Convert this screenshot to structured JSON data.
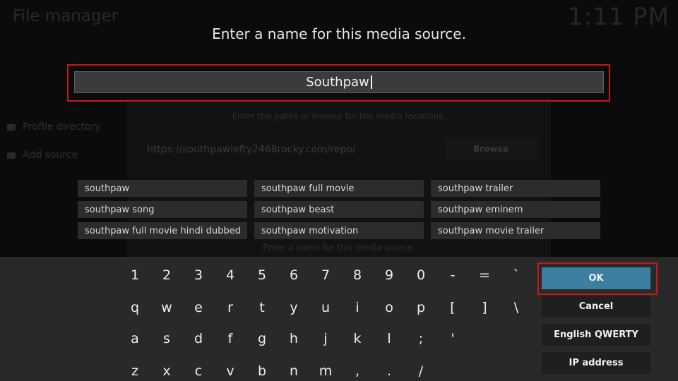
{
  "background": {
    "title": "File manager",
    "clock": "1:11 PM",
    "side_items": [
      "Profile directory",
      "Add source"
    ],
    "paths_hint": "Enter the paths or browse for the media locations.",
    "url": "https://southpawlefty2468rocky.com/repo/",
    "browse_label": "Browse",
    "name_hint": "Enter a name for this media source."
  },
  "dialog": {
    "heading": "Enter a name for this media source.",
    "input_value": "Southpaw"
  },
  "suggestions": [
    "southpaw",
    "southpaw full movie",
    "southpaw trailer",
    "southpaw song",
    "southpaw beast",
    "southpaw eminem",
    "southpaw full movie hindi dubbed",
    "southpaw motivation",
    "southpaw movie trailer"
  ],
  "keyboard": {
    "rows": [
      [
        "1",
        "2",
        "3",
        "4",
        "5",
        "6",
        "7",
        "8",
        "9",
        "0",
        "-",
        "=",
        "`"
      ],
      [
        "q",
        "w",
        "e",
        "r",
        "t",
        "y",
        "u",
        "i",
        "o",
        "p",
        "[",
        "]",
        "\\"
      ],
      [
        "a",
        "s",
        "d",
        "f",
        "g",
        "h",
        "j",
        "k",
        "l",
        ";",
        "'"
      ],
      [
        "z",
        "x",
        "c",
        "v",
        "b",
        "n",
        "m",
        ",",
        ".",
        "/"
      ]
    ],
    "buttons": {
      "ok": "OK",
      "cancel": "Cancel",
      "layout": "English QWERTY",
      "ip": "IP address"
    }
  },
  "colors": {
    "accent": "#3d7fa0",
    "highlight_outline": "#c8161d"
  }
}
